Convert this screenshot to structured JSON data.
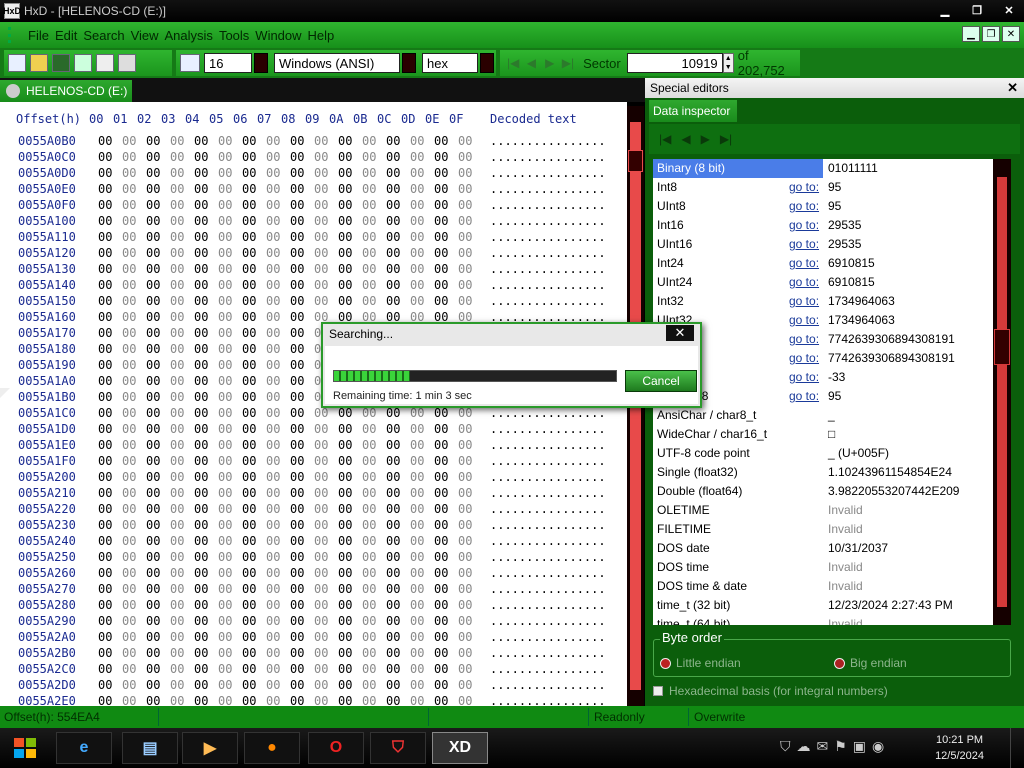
{
  "window": {
    "title": "HxD - [HELENOS-CD (E:)]",
    "app_icon": "HxD"
  },
  "menu": [
    "File",
    "Edit",
    "Search",
    "View",
    "Analysis",
    "Tools",
    "Window",
    "Help"
  ],
  "toolbar": {
    "bytes_per_row": "16",
    "charset": "Windows (ANSI)",
    "offset_base": "hex",
    "sector_label": "Sector",
    "sector_value": "10919",
    "sector_total": "of 202,752"
  },
  "tab": {
    "label": "HELENOS-CD (E:)"
  },
  "hex": {
    "header_offset": "Offset(h)",
    "header_cols": [
      "00",
      "01",
      "02",
      "03",
      "04",
      "05",
      "06",
      "07",
      "08",
      "09",
      "0A",
      "0B",
      "0C",
      "0D",
      "0E",
      "0F"
    ],
    "header_text": "Decoded text",
    "byte": "00",
    "decoded": "................",
    "rows": [
      "0055A0B0",
      "0055A0C0",
      "0055A0D0",
      "0055A0E0",
      "0055A0F0",
      "0055A100",
      "0055A110",
      "0055A120",
      "0055A130",
      "0055A140",
      "0055A150",
      "0055A160",
      "0055A170",
      "0055A180",
      "0055A190",
      "0055A1A0",
      "0055A1B0",
      "0055A1C0",
      "0055A1D0",
      "0055A1E0",
      "0055A1F0",
      "0055A200",
      "0055A210",
      "0055A220",
      "0055A230",
      "0055A240",
      "0055A250",
      "0055A260",
      "0055A270",
      "0055A280",
      "0055A290",
      "0055A2A0",
      "0055A2B0",
      "0055A2C0",
      "0055A2D0",
      "0055A2E0"
    ]
  },
  "special_editors": {
    "title": "Special editors",
    "tab": "Data inspector",
    "goto_label": "go to:",
    "rows": [
      {
        "name": "Binary (8 bit)",
        "value": "01011111",
        "goto": false,
        "selected": true
      },
      {
        "name": "Int8",
        "value": "95",
        "goto": true
      },
      {
        "name": "UInt8",
        "value": "95",
        "goto": true
      },
      {
        "name": "Int16",
        "value": "29535",
        "goto": true
      },
      {
        "name": "UInt16",
        "value": "29535",
        "goto": true
      },
      {
        "name": "Int24",
        "value": "6910815",
        "goto": true
      },
      {
        "name": "UInt24",
        "value": "6910815",
        "goto": true
      },
      {
        "name": "Int32",
        "value": "1734964063",
        "goto": true
      },
      {
        "name": "UInt32",
        "value": "1734964063",
        "goto": true
      },
      {
        "name": "Int64",
        "value": "7742639306894308191",
        "goto": true
      },
      {
        "name": "UInt64",
        "value": "7742639306894308191",
        "goto": true
      },
      {
        "name": "LEB128",
        "value": "-33",
        "goto": true
      },
      {
        "name": "ULEB128",
        "value": "95",
        "goto": true
      },
      {
        "name": "AnsiChar / char8_t",
        "value": "_",
        "goto": false
      },
      {
        "name": "WideChar / char16_t",
        "value": "□",
        "goto": false
      },
      {
        "name": "UTF-8 code point",
        "value": "_ (U+005F)",
        "goto": false
      },
      {
        "name": "Single (float32)",
        "value": "1.10243961154854E24",
        "goto": false
      },
      {
        "name": "Double (float64)",
        "value": "3.98220553207442E209",
        "goto": false
      },
      {
        "name": "OLETIME",
        "value": "Invalid",
        "goto": false,
        "invalid": true
      },
      {
        "name": "FILETIME",
        "value": "Invalid",
        "goto": false,
        "invalid": true
      },
      {
        "name": "DOS date",
        "value": "10/31/2037",
        "goto": false
      },
      {
        "name": "DOS time",
        "value": "Invalid",
        "goto": false,
        "invalid": true
      },
      {
        "name": "DOS time & date",
        "value": "Invalid",
        "goto": false,
        "invalid": true
      },
      {
        "name": "time_t (32 bit)",
        "value": "12/23/2024 2:27:43 PM",
        "goto": false
      },
      {
        "name": "time_t (64 bit)",
        "value": "Invalid",
        "goto": false,
        "invalid": true
      }
    ],
    "byte_order_label": "Byte order",
    "little_endian": "Little endian",
    "big_endian": "Big endian",
    "hex_basis": "Hexadecimal basis (for integral numbers)"
  },
  "status": {
    "offset": "Offset(h): 554EA4",
    "mode": "Readonly",
    "insert": "Overwrite"
  },
  "dialog": {
    "title": "Searching...",
    "remaining": "Remaining time: 1 min 3 sec",
    "cancel": "Cancel",
    "progress_fraction": 0.27
  },
  "clock": {
    "time": "10:21 PM",
    "date": "12/5/2024"
  }
}
